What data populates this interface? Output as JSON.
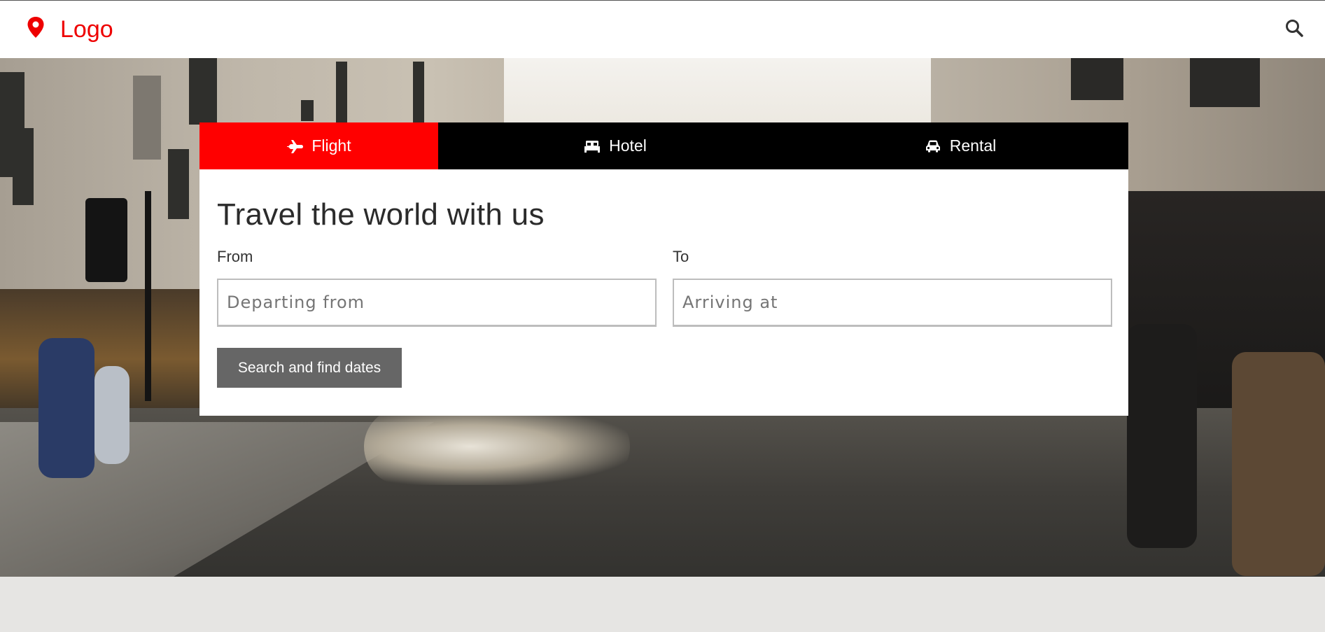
{
  "header": {
    "logo_text": "Logo",
    "logo_icon": "map-pin-icon",
    "search_icon": "search-icon",
    "accent_color": "#ee0000"
  },
  "tabs": [
    {
      "label": "Flight",
      "icon": "plane-icon",
      "active": true
    },
    {
      "label": "Hotel",
      "icon": "bed-icon",
      "active": false
    },
    {
      "label": "Rental",
      "icon": "car-icon",
      "active": false
    }
  ],
  "form": {
    "title": "Travel the world with us",
    "from_label": "From",
    "from_placeholder": "Departing from",
    "from_value": "",
    "to_label": "To",
    "to_placeholder": "Arriving at",
    "to_value": "",
    "submit_label": "Search and find dates"
  },
  "colors": {
    "active_tab": "#ff0000",
    "tab_bar": "#000000",
    "button": "#666666",
    "page_background": "#e6e5e3"
  }
}
